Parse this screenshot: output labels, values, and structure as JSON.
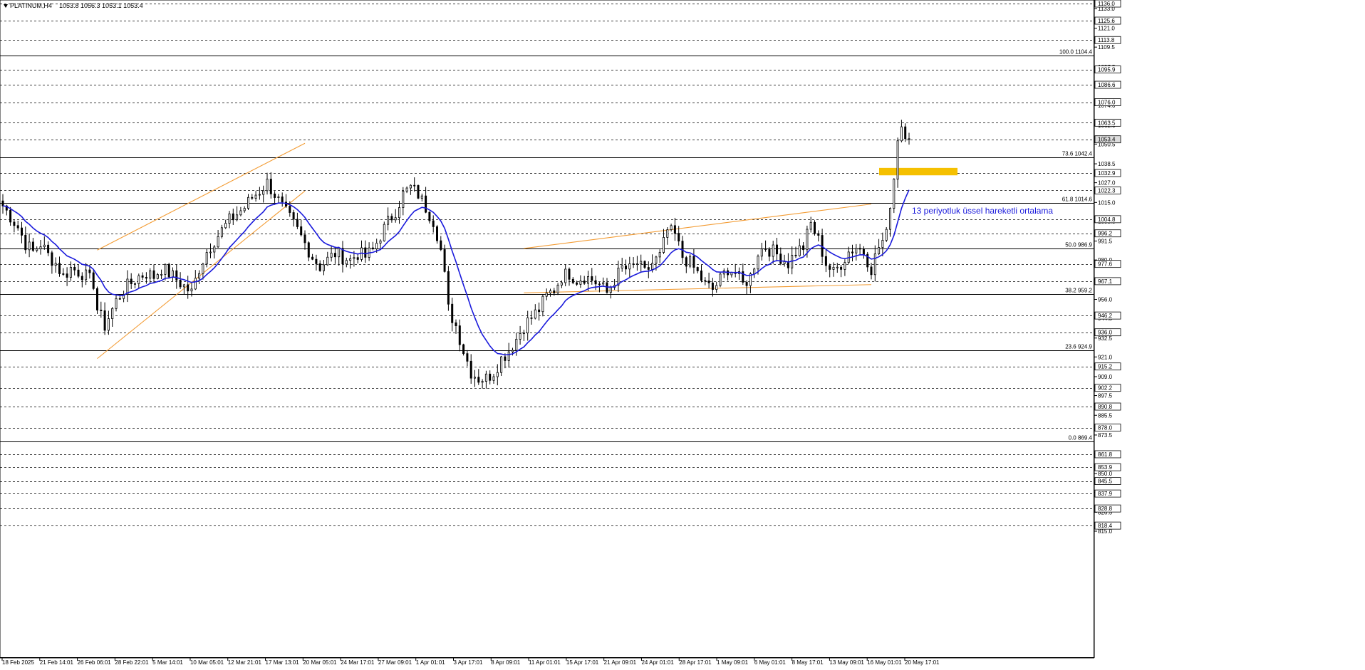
{
  "header": {
    "symbol_label": "PLATINUM,H4",
    "ohlc_values": "1053.8 1056.3 1053.1 1053.4"
  },
  "annotation": {
    "ema_label": "13 periyotluk üssel hareketli ortalama"
  },
  "colors": {
    "background": "#ffffff",
    "candle": "#000000",
    "ema": "#1a1adc",
    "channel": "#f39c34",
    "highlight": "#f5c000",
    "ema_label": "#1a1adc"
  },
  "chart_data": {
    "type": "candlestick",
    "symbol": "PLATINUM",
    "timeframe": "H4",
    "ylim": [
      815.0,
      1136.0
    ],
    "x_tick_labels": [
      "18 Feb 2025",
      "21 Feb 14:01",
      "26 Feb 06:01",
      "28 Feb 22:01",
      "5 Mar 14:01",
      "10 Mar 05:01",
      "12 Mar 21:01",
      "17 Mar 13:01",
      "20 Mar 05:01",
      "24 Mar 17:01",
      "27 Mar 09:01",
      "1 Apr 01:01",
      "3 Apr 17:01",
      "8 Apr 09:01",
      "11 Apr 01:01",
      "15 Apr 17:01",
      "21 Apr 09:01",
      "24 Apr 01:01",
      "28 Apr 17:01",
      "1 May 09:01",
      "6 May 01:01",
      "8 May 17:01",
      "13 May 09:01",
      "16 May 01:01",
      "20 May 17:01"
    ],
    "y_tick_labels": [
      "1133.0",
      "1121.0",
      "1109.5",
      "1097.5",
      "1074.0",
      "1062.0",
      "1050.5",
      "1038.5",
      "1027.0",
      "1015.0",
      "1003.5",
      "991.5",
      "980.0",
      "968.0",
      "956.0",
      "944.5",
      "932.5",
      "921.0",
      "909.0",
      "897.5",
      "885.5",
      "873.5",
      "862.0",
      "850.0",
      "838.5",
      "826.5",
      "815.0"
    ],
    "price_labels": [
      1136.0,
      1125.6,
      1113.8,
      1095.9,
      1086.6,
      1076.0,
      1063.5,
      1053.4,
      1032.9,
      1022.3,
      1004.8,
      996.2,
      977.6,
      967.1,
      946.2,
      936.0,
      915.2,
      902.2,
      890.8,
      878.0,
      861.8,
      853.9,
      845.5,
      837.9,
      828.8,
      818.4
    ],
    "current_price": 1053.4,
    "highlighted_price": 1053.4,
    "fibonacci_levels": [
      {
        "label": "100.0 1104.4",
        "price": 1104.4
      },
      {
        "label": "73.6 1042.4",
        "price": 1042.4
      },
      {
        "label": "61.8 1014.6",
        "price": 1014.6
      },
      {
        "label": "50.0 986.9",
        "price": 986.9
      },
      {
        "label": "38.2 959.2",
        "price": 959.2
      },
      {
        "label": "23.6 924.9",
        "price": 924.9
      },
      {
        "label": "0.0 869.4",
        "price": 869.4
      }
    ],
    "support_resistance_zone": {
      "low": 1031.5,
      "high": 1036.0
    },
    "close_path": [
      [
        0,
        1013
      ],
      [
        4,
        1000
      ],
      [
        6,
        990
      ],
      [
        8,
        985
      ],
      [
        10,
        990
      ],
      [
        12,
        983
      ],
      [
        14,
        978
      ],
      [
        16,
        970
      ],
      [
        18,
        975
      ],
      [
        21,
        972
      ],
      [
        24,
        966
      ],
      [
        25,
        950
      ],
      [
        27,
        940
      ],
      [
        28,
        945
      ],
      [
        30,
        955
      ],
      [
        32,
        962
      ],
      [
        34,
        966
      ],
      [
        36,
        970
      ],
      [
        38,
        972
      ],
      [
        40,
        970
      ],
      [
        42,
        975
      ],
      [
        44,
        972
      ],
      [
        46,
        968
      ],
      [
        48,
        964
      ],
      [
        50,
        960
      ],
      [
        52,
        975
      ],
      [
        54,
        985
      ],
      [
        56,
        992
      ],
      [
        58,
        998
      ],
      [
        60,
        1004
      ],
      [
        62,
        1008
      ],
      [
        64,
        1012
      ],
      [
        66,
        1018
      ],
      [
        68,
        1022
      ],
      [
        70,
        1027
      ],
      [
        72,
        1020
      ],
      [
        74,
        1012
      ],
      [
        76,
        1005
      ],
      [
        78,
        998
      ],
      [
        80,
        990
      ],
      [
        82,
        982
      ],
      [
        84,
        976
      ],
      [
        86,
        980
      ],
      [
        88,
        984
      ],
      [
        90,
        982
      ],
      [
        92,
        980
      ],
      [
        94,
        984
      ],
      [
        96,
        982
      ],
      [
        98,
        986
      ],
      [
        100,
        995
      ],
      [
        102,
        1003
      ],
      [
        104,
        1010
      ],
      [
        106,
        1020
      ],
      [
        108,
        1024
      ],
      [
        110,
        1020
      ],
      [
        112,
        1012
      ],
      [
        114,
        1004
      ],
      [
        115,
        996
      ],
      [
        116,
        986
      ],
      [
        117,
        970
      ],
      [
        118,
        950
      ],
      [
        120,
        940
      ],
      [
        122,
        925
      ],
      [
        124,
        912
      ],
      [
        126,
        908
      ],
      [
        128,
        908
      ],
      [
        130,
        912
      ],
      [
        132,
        920
      ],
      [
        134,
        925
      ],
      [
        136,
        932
      ],
      [
        138,
        940
      ],
      [
        140,
        945
      ],
      [
        142,
        950
      ],
      [
        144,
        958
      ],
      [
        146,
        962
      ],
      [
        148,
        970
      ],
      [
        150,
        972
      ],
      [
        152,
        968
      ],
      [
        154,
        970
      ],
      [
        156,
        968
      ],
      [
        158,
        965
      ],
      [
        160,
        960
      ],
      [
        162,
        968
      ],
      [
        164,
        975
      ],
      [
        166,
        974
      ],
      [
        168,
        978
      ],
      [
        170,
        972
      ],
      [
        172,
        978
      ],
      [
        174,
        982
      ],
      [
        176,
        998
      ],
      [
        178,
        995
      ],
      [
        180,
        982
      ],
      [
        182,
        978
      ],
      [
        184,
        972
      ],
      [
        186,
        965
      ],
      [
        188,
        962
      ],
      [
        190,
        968
      ],
      [
        192,
        975
      ],
      [
        194,
        972
      ],
      [
        196,
        965
      ],
      [
        198,
        970
      ],
      [
        200,
        985
      ],
      [
        202,
        988
      ],
      [
        204,
        985
      ],
      [
        206,
        982
      ],
      [
        208,
        978
      ],
      [
        210,
        985
      ],
      [
        212,
        988
      ],
      [
        214,
        1002
      ],
      [
        216,
        992
      ],
      [
        218,
        978
      ],
      [
        220,
        972
      ],
      [
        222,
        978
      ],
      [
        224,
        985
      ],
      [
        226,
        988
      ],
      [
        228,
        985
      ],
      [
        230,
        975
      ],
      [
        232,
        988
      ],
      [
        234,
        995
      ],
      [
        235,
        1015
      ],
      [
        236,
        1030
      ],
      [
        237,
        1055
      ],
      [
        238,
        1062
      ],
      [
        239,
        1058
      ],
      [
        240,
        1053.4
      ]
    ],
    "channels": [
      {
        "name": "early-channel-upper",
        "points": [
          [
            25,
            986
          ],
          [
            80,
            1051
          ]
        ]
      },
      {
        "name": "early-channel-lower",
        "points": [
          [
            25,
            920
          ],
          [
            80,
            1022
          ]
        ]
      },
      {
        "name": "late-channel-upper",
        "points": [
          [
            138,
            987
          ],
          [
            230,
            1014
          ]
        ]
      },
      {
        "name": "late-channel-lower",
        "points": [
          [
            138,
            960
          ],
          [
            230,
            965
          ]
        ]
      }
    ],
    "ema": {
      "period": 13
    }
  }
}
